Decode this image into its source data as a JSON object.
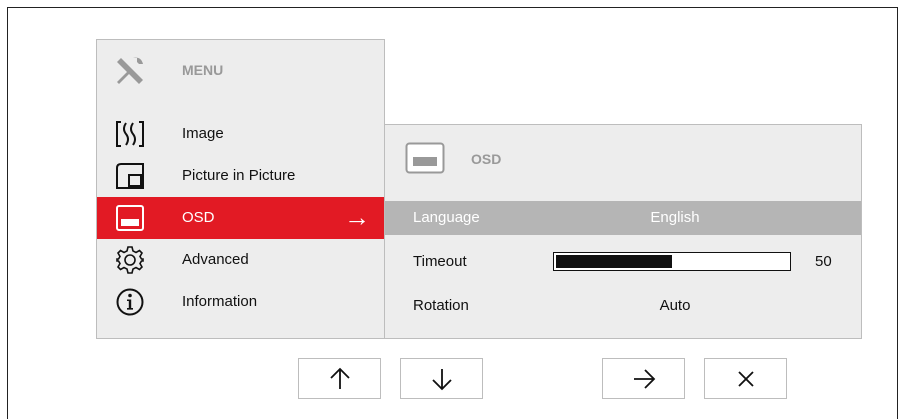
{
  "menu": {
    "title": "MENU",
    "header_icon": "tools-icon",
    "items": [
      {
        "label": "Image",
        "icon": "image-wave-icon"
      },
      {
        "label": "Picture in Picture",
        "icon": "pip-icon"
      },
      {
        "label": "OSD",
        "icon": "osd-icon",
        "active": true
      },
      {
        "label": "Advanced",
        "icon": "gear-icon"
      },
      {
        "label": "Information",
        "icon": "info-icon"
      }
    ],
    "active_arrow": "→"
  },
  "osd": {
    "title": "OSD",
    "rows": [
      {
        "label": "Language",
        "value": "English"
      },
      {
        "label": "Timeout",
        "value": "50",
        "slider_percent": 50
      },
      {
        "label": "Rotation",
        "value": "Auto"
      }
    ]
  },
  "nav": {
    "buttons": [
      "up-arrow-icon",
      "down-arrow-icon",
      "right-arrow-icon",
      "close-icon"
    ]
  },
  "colors": {
    "active": "#e21a24",
    "highlight_row": "#b5b5b5",
    "panel_bg": "#ededed"
  }
}
